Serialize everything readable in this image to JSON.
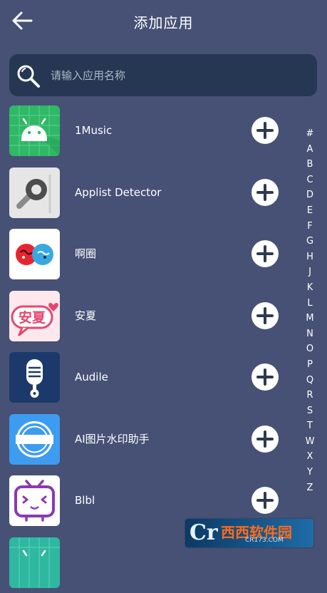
{
  "header": {
    "title": "添加应用"
  },
  "search": {
    "placeholder": "请输入应用名称"
  },
  "apps": [
    {
      "name": "1Music",
      "icon": "android-icon"
    },
    {
      "name": "Applist Detector",
      "icon": "magnifier-app-icon"
    },
    {
      "name": "啊圈",
      "icon": "a-quan-app-icon"
    },
    {
      "name": "安夏",
      "icon": "an-xia-app-icon"
    },
    {
      "name": "Audile",
      "icon": "microphone-app-icon"
    },
    {
      "name": "AI图片水印助手",
      "icon": "watermark-badge-icon"
    },
    {
      "name": "Blbl",
      "icon": "tv-face-icon"
    }
  ],
  "alphabet": [
    "#",
    "A",
    "B",
    "C",
    "D",
    "E",
    "F",
    "G",
    "H",
    "J",
    "K",
    "L",
    "M",
    "N",
    "O",
    "P",
    "Q",
    "R",
    "S",
    "T",
    "W",
    "X",
    "Y",
    "Z"
  ],
  "watermark": {
    "logo": "Cr",
    "text": "西西软件园",
    "sub": "CR173.COM"
  },
  "colors": {
    "background": "#465175",
    "search_bg": "#253752",
    "button_bg": "#ffffff"
  }
}
